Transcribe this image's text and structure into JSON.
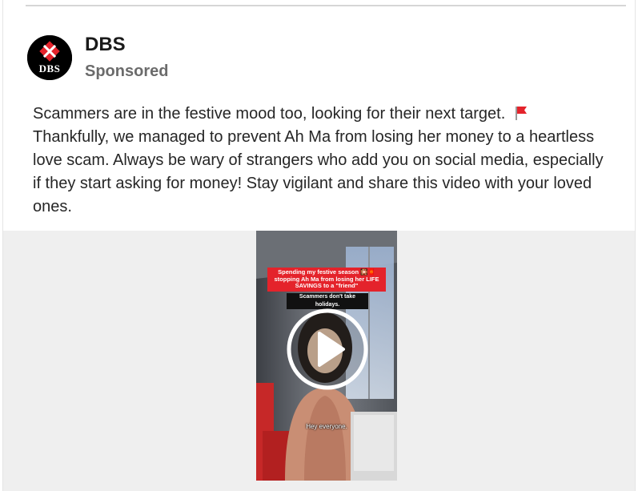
{
  "post": {
    "brand_name": "DBS",
    "sponsored_label": "Sponsored",
    "avatar_text": "DBS",
    "body_text": "Scammers are in the festive mood too, looking for their next target.",
    "body_text_2": "Thankfully, we managed to prevent Ah Ma from losing her money to a heartless love scam. Always be wary of strangers who add you on social media, especially if they start asking for money! Stay vigilant and share this video with your loved ones.",
    "flag_icon": "red-flag-emoji"
  },
  "video": {
    "caption_red": "Spending my festive season 🎇🧧 stopping Ah Ma from losing her LIFE SAVINGS to a \"friend\"",
    "caption_black": "Scammers don't take holidays.",
    "subtitle": "Hey everyone.",
    "play_icon": "play-icon"
  },
  "colors": {
    "brand_red": "#e4232b",
    "text": "#262626",
    "muted": "#6b6b6b"
  }
}
